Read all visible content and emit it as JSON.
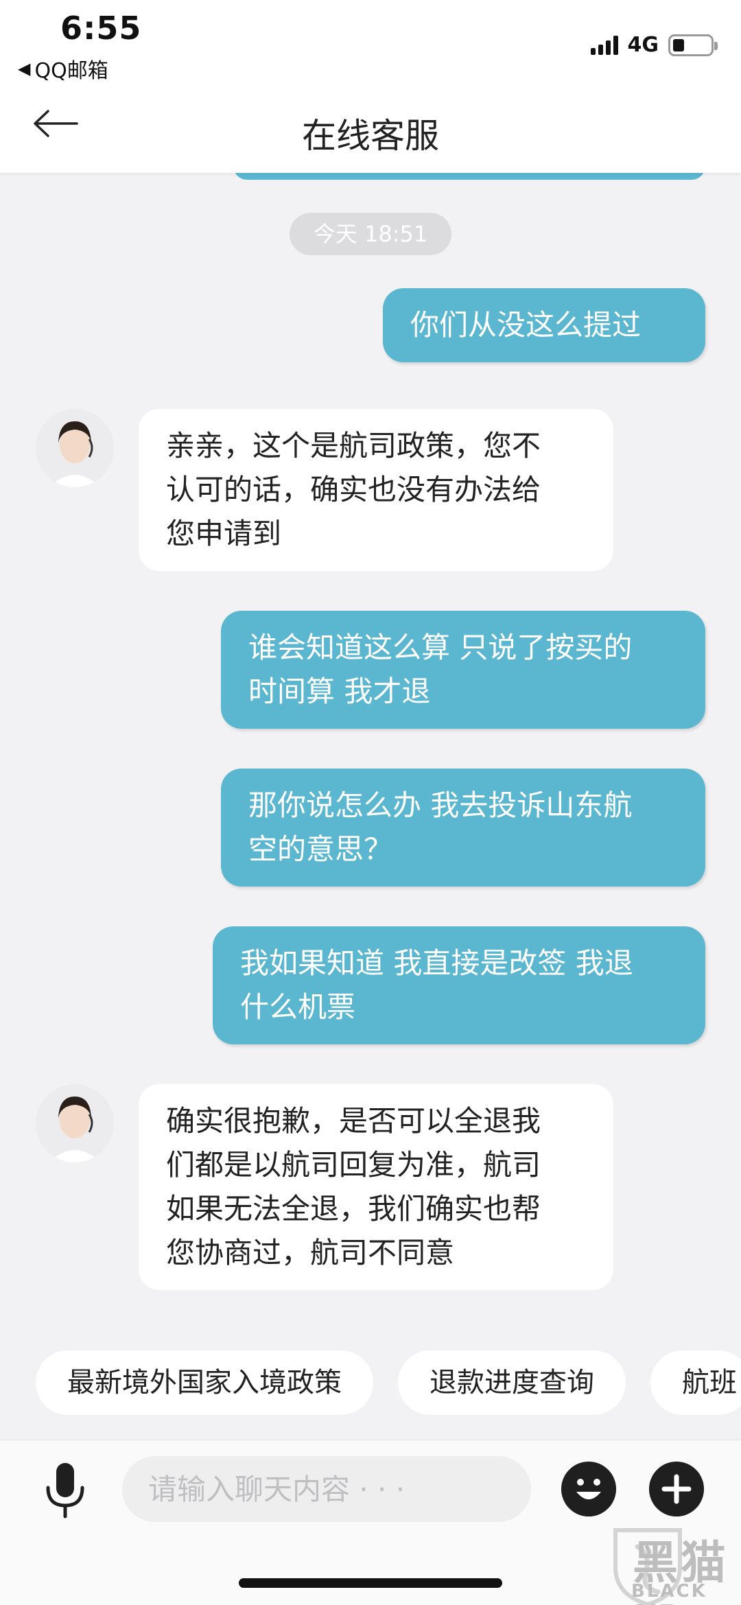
{
  "status_bar": {
    "time": "6:55",
    "back_app": "QQ邮箱",
    "network": "4G",
    "battery_level": 0.3
  },
  "header": {
    "title": "在线客服"
  },
  "chat": {
    "timestamp": "今天 18:51",
    "messages": [
      {
        "from": "user",
        "text": "你们从没这么提过"
      },
      {
        "from": "agent",
        "text": "亲亲，这个是航司政策，您不\n认可的话，确实也没有办法给\n您申请到"
      },
      {
        "from": "user",
        "text": "谁会知道这么算 只说了按买的\n时间算 我才退"
      },
      {
        "from": "user",
        "text": "那你说怎么办 我去投诉山东航\n空的意思？"
      },
      {
        "from": "user",
        "text": "我如果知道 我直接是改签 我退\n什么机票"
      },
      {
        "from": "agent",
        "text": "确实很抱歉，是否可以全退我\n们都是以航司回复为准，航司\n如果无法全退，我们确实也帮\n您协商过，航司不同意"
      }
    ]
  },
  "quick_replies": [
    "最新境外国家入境政策",
    "退款进度查询",
    "航班"
  ],
  "input": {
    "placeholder": "请输入聊天内容 · · ·"
  },
  "watermark": {
    "cn": "黑猫",
    "en": "BLACK CAT"
  },
  "colors": {
    "user_bubble": "#5bb7d0",
    "agent_bubble": "#ffffff",
    "background": "#f2f2f4"
  }
}
